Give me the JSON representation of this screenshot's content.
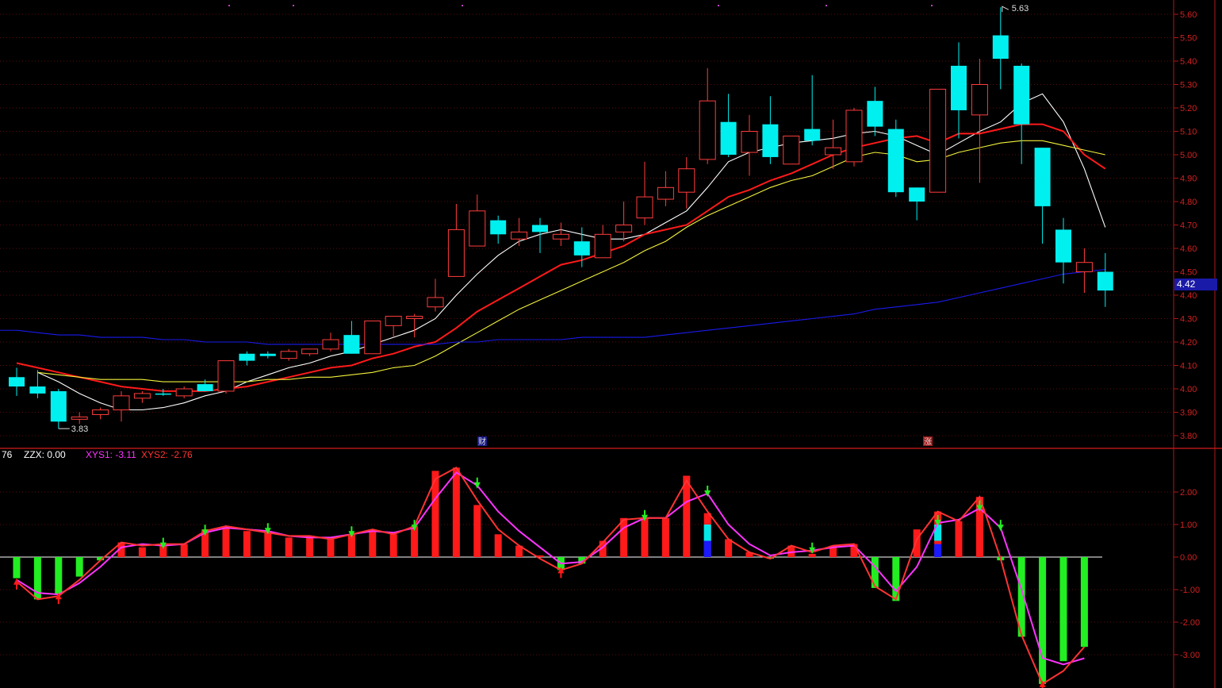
{
  "chart_data": [
    {
      "type": "candlestick",
      "title": "",
      "ylim": [
        3.75,
        5.65
      ],
      "yticks": [
        "5.60",
        "5.50",
        "5.40",
        "5.30",
        "5.20",
        "5.10",
        "5.00",
        "4.90",
        "4.80",
        "4.70",
        "4.60",
        "4.50",
        "4.40",
        "4.30",
        "4.20",
        "4.10",
        "4.00",
        "3.90",
        "3.80"
      ],
      "grid": true,
      "last_price": "4.42",
      "high_label": "5.63",
      "low_label": "3.83",
      "event_markers": [
        "财",
        "涨"
      ],
      "candles": [
        {
          "o": 4.05,
          "h": 4.09,
          "l": 3.97,
          "c": 4.01,
          "up": false
        },
        {
          "o": 4.01,
          "h": 4.08,
          "l": 3.96,
          "c": 3.98,
          "up": false
        },
        {
          "o": 3.99,
          "h": 4.0,
          "l": 3.83,
          "c": 3.86,
          "up": false
        },
        {
          "o": 3.87,
          "h": 3.9,
          "l": 3.85,
          "c": 3.88,
          "up": true
        },
        {
          "o": 3.89,
          "h": 3.92,
          "l": 3.87,
          "c": 3.91,
          "up": true
        },
        {
          "o": 3.91,
          "h": 3.99,
          "l": 3.86,
          "c": 3.97,
          "up": true
        },
        {
          "o": 3.96,
          "h": 3.99,
          "l": 3.94,
          "c": 3.98,
          "up": true
        },
        {
          "o": 3.98,
          "h": 4.0,
          "l": 3.97,
          "c": 3.98,
          "up": false
        },
        {
          "o": 3.97,
          "h": 4.01,
          "l": 3.96,
          "c": 4.0,
          "up": true
        },
        {
          "o": 4.02,
          "h": 4.04,
          "l": 3.99,
          "c": 3.99,
          "up": false
        },
        {
          "o": 3.99,
          "h": 4.12,
          "l": 3.98,
          "c": 4.12,
          "up": true
        },
        {
          "o": 4.15,
          "h": 4.16,
          "l": 4.1,
          "c": 4.12,
          "up": false
        },
        {
          "o": 4.14,
          "h": 4.16,
          "l": 4.13,
          "c": 4.15,
          "up": false
        },
        {
          "o": 4.13,
          "h": 4.17,
          "l": 4.12,
          "c": 4.16,
          "up": true
        },
        {
          "o": 4.15,
          "h": 4.17,
          "l": 4.14,
          "c": 4.17,
          "up": true
        },
        {
          "o": 4.17,
          "h": 4.24,
          "l": 4.16,
          "c": 4.21,
          "up": true
        },
        {
          "o": 4.23,
          "h": 4.29,
          "l": 4.15,
          "c": 4.15,
          "up": false
        },
        {
          "o": 4.15,
          "h": 4.29,
          "l": 4.15,
          "c": 4.29,
          "up": true
        },
        {
          "o": 4.27,
          "h": 4.31,
          "l": 4.22,
          "c": 4.31,
          "up": true
        },
        {
          "o": 4.3,
          "h": 4.32,
          "l": 4.22,
          "c": 4.31,
          "up": true
        },
        {
          "o": 4.35,
          "h": 4.47,
          "l": 4.33,
          "c": 4.39,
          "up": true
        },
        {
          "o": 4.48,
          "h": 4.79,
          "l": 4.48,
          "c": 4.68,
          "up": true
        },
        {
          "o": 4.61,
          "h": 4.83,
          "l": 4.61,
          "c": 4.76,
          "up": true
        },
        {
          "o": 4.72,
          "h": 4.74,
          "l": 4.62,
          "c": 4.66,
          "up": false
        },
        {
          "o": 4.64,
          "h": 4.73,
          "l": 4.61,
          "c": 4.67,
          "up": true
        },
        {
          "o": 4.7,
          "h": 4.73,
          "l": 4.58,
          "c": 4.67,
          "up": false
        },
        {
          "o": 4.64,
          "h": 4.71,
          "l": 4.61,
          "c": 4.66,
          "up": true
        },
        {
          "o": 4.63,
          "h": 4.69,
          "l": 4.52,
          "c": 4.57,
          "up": false
        },
        {
          "o": 4.56,
          "h": 4.7,
          "l": 4.56,
          "c": 4.66,
          "up": true
        },
        {
          "o": 4.67,
          "h": 4.8,
          "l": 4.63,
          "c": 4.7,
          "up": true
        },
        {
          "o": 4.73,
          "h": 4.97,
          "l": 4.7,
          "c": 4.82,
          "up": true
        },
        {
          "o": 4.81,
          "h": 4.93,
          "l": 4.78,
          "c": 4.86,
          "up": true
        },
        {
          "o": 4.84,
          "h": 4.99,
          "l": 4.77,
          "c": 4.94,
          "up": true
        },
        {
          "o": 4.98,
          "h": 5.37,
          "l": 4.96,
          "c": 5.23,
          "up": true
        },
        {
          "o": 5.14,
          "h": 5.26,
          "l": 4.99,
          "c": 5.0,
          "up": false
        },
        {
          "o": 5.01,
          "h": 5.17,
          "l": 4.91,
          "c": 5.1,
          "up": true
        },
        {
          "o": 5.13,
          "h": 5.25,
          "l": 4.96,
          "c": 4.99,
          "up": false
        },
        {
          "o": 4.96,
          "h": 5.08,
          "l": 4.96,
          "c": 5.08,
          "up": true
        },
        {
          "o": 5.11,
          "h": 5.34,
          "l": 5.04,
          "c": 5.06,
          "up": false
        },
        {
          "o": 5.0,
          "h": 5.15,
          "l": 4.94,
          "c": 5.03,
          "up": true
        },
        {
          "o": 4.97,
          "h": 5.2,
          "l": 4.95,
          "c": 5.19,
          "up": true
        },
        {
          "o": 5.23,
          "h": 5.29,
          "l": 5.08,
          "c": 5.12,
          "up": false
        },
        {
          "o": 5.11,
          "h": 5.15,
          "l": 4.82,
          "c": 4.84,
          "up": false
        },
        {
          "o": 4.86,
          "h": 4.86,
          "l": 4.72,
          "c": 4.8,
          "up": false
        },
        {
          "o": 4.84,
          "h": 5.28,
          "l": 4.84,
          "c": 5.28,
          "up": true
        },
        {
          "o": 5.38,
          "h": 5.48,
          "l": 5.07,
          "c": 5.19,
          "up": false
        },
        {
          "o": 5.17,
          "h": 5.41,
          "l": 4.88,
          "c": 5.3,
          "up": true
        },
        {
          "o": 5.51,
          "h": 5.63,
          "l": 5.28,
          "c": 5.41,
          "up": false
        },
        {
          "o": 5.38,
          "h": 5.39,
          "l": 4.96,
          "c": 5.13,
          "up": false
        },
        {
          "o": 5.03,
          "h": 5.03,
          "l": 4.62,
          "c": 4.78,
          "up": false
        },
        {
          "o": 4.68,
          "h": 4.73,
          "l": 4.45,
          "c": 4.54,
          "up": false
        },
        {
          "o": 4.5,
          "h": 4.6,
          "l": 4.41,
          "c": 4.54,
          "up": true
        },
        {
          "o": 4.5,
          "h": 4.58,
          "l": 4.35,
          "c": 4.42,
          "up": false
        }
      ],
      "series": [
        {
          "color": "#ffffff",
          "values": [
            4.07,
            4.03,
            3.98,
            3.94,
            3.91,
            3.91,
            3.92,
            3.94,
            3.97,
            3.99,
            4.03,
            4.06,
            4.09,
            4.11,
            4.14,
            4.16,
            4.19,
            4.22,
            4.25,
            4.3,
            4.4,
            4.49,
            4.57,
            4.63,
            4.66,
            4.68,
            4.66,
            4.64,
            4.64,
            4.66,
            4.71,
            4.76,
            4.86,
            4.97,
            5.01,
            5.03,
            5.05,
            5.06,
            5.07,
            5.09,
            5.1,
            5.08,
            5.04,
            5.0,
            5.05,
            5.1,
            5.14,
            5.22,
            5.26,
            5.14,
            4.94,
            4.69
          ]
        },
        {
          "color": "#ff1a1a",
          "values": [
            4.11,
            4.09,
            4.07,
            4.05,
            4.03,
            4.01,
            4.0,
            3.99,
            3.99,
            3.99,
            4.0,
            4.01,
            4.03,
            4.05,
            4.07,
            4.09,
            4.1,
            4.13,
            4.15,
            4.18,
            4.2,
            4.26,
            4.33,
            4.38,
            4.43,
            4.48,
            4.53,
            4.55,
            4.58,
            4.61,
            4.66,
            4.68,
            4.7,
            4.76,
            4.82,
            4.85,
            4.89,
            4.92,
            4.96,
            5.0,
            5.03,
            5.05,
            5.07,
            5.08,
            5.05,
            5.09,
            5.09,
            5.11,
            5.13,
            5.13,
            5.1,
            5.0,
            4.94
          ]
        },
        {
          "color": "#f2f23c",
          "values": [
            4.07,
            4.06,
            4.05,
            4.04,
            4.04,
            4.04,
            4.03,
            4.03,
            4.03,
            4.03,
            4.03,
            4.04,
            4.04,
            4.05,
            4.05,
            4.06,
            4.07,
            4.09,
            4.1,
            4.14,
            4.19,
            4.24,
            4.29,
            4.34,
            4.38,
            4.42,
            4.46,
            4.5,
            4.54,
            4.59,
            4.63,
            4.69,
            4.74,
            4.78,
            4.82,
            4.86,
            4.89,
            4.91,
            4.95,
            4.99,
            5.01,
            5.0,
            4.97,
            4.98,
            5.01,
            5.03,
            5.05,
            5.06,
            5.06,
            5.04,
            5.02,
            5.0
          ]
        },
        {
          "color": "#1a1aee",
          "values": [
            4.25,
            4.24,
            4.23,
            4.23,
            4.22,
            4.22,
            4.22,
            4.21,
            4.21,
            4.2,
            4.2,
            4.2,
            4.19,
            4.19,
            4.19,
            4.19,
            4.19,
            4.19,
            4.19,
            4.19,
            4.19,
            4.2,
            4.2,
            4.21,
            4.21,
            4.21,
            4.21,
            4.22,
            4.22,
            4.22,
            4.22,
            4.23,
            4.24,
            4.25,
            4.26,
            4.27,
            4.28,
            4.29,
            4.3,
            4.31,
            4.32,
            4.34,
            4.35,
            4.36,
            4.37,
            4.39,
            4.41,
            4.43,
            4.45,
            4.47,
            4.49,
            4.5,
            4.51
          ]
        }
      ]
    },
    {
      "type": "bar",
      "ylim": [
        -3.4,
        3.0
      ],
      "yticks": [
        "2.00",
        "1.00",
        "0.00",
        "-1.00",
        "-2.00",
        "-3.00"
      ],
      "legend": [
        {
          "text": "76",
          "color": "#ffffff"
        },
        {
          "text": "ZZX: 0.00",
          "color": "#ffffff"
        },
        {
          "text": "XYS1: -3.11",
          "color": "#ff33ff"
        },
        {
          "text": "XYS2: -2.76",
          "color": "#ff3333"
        }
      ],
      "values": [
        -0.65,
        -1.3,
        -1.15,
        -0.6,
        -0.1,
        0.45,
        0.3,
        0.4,
        0.4,
        0.85,
        0.95,
        0.8,
        0.75,
        0.6,
        0.65,
        0.55,
        0.7,
        0.85,
        0.7,
        0.95,
        2.65,
        2.75,
        1.6,
        0.7,
        0.35,
        0.05,
        -0.4,
        -0.2,
        0.5,
        1.2,
        1.2,
        1.2,
        2.5,
        1.35,
        0.55,
        0.15,
        -0.05,
        0.35,
        0.1,
        0.35,
        0.4,
        -0.95,
        -1.35,
        0.85,
        1.4,
        1.1,
        1.85,
        -0.1,
        -2.45,
        -3.9,
        -3.2,
        -2.76
      ],
      "series": [
        {
          "name": "XYS1",
          "color": "#ff33ff",
          "values": [
            -0.7,
            -1.1,
            -1.15,
            -0.8,
            -0.3,
            0.3,
            0.4,
            0.35,
            0.4,
            0.75,
            0.9,
            0.85,
            0.8,
            0.65,
            0.6,
            0.6,
            0.7,
            0.8,
            0.75,
            0.9,
            1.8,
            2.6,
            2.2,
            1.4,
            0.8,
            0.3,
            -0.2,
            -0.15,
            0.3,
            0.9,
            1.2,
            1.2,
            1.7,
            1.95,
            1.0,
            0.4,
            0.05,
            0.15,
            0.2,
            0.3,
            0.35,
            -0.3,
            -1.05,
            -0.3,
            1.05,
            1.15,
            1.5,
            0.9,
            -1.0,
            -3.1,
            -3.3,
            -3.11
          ]
        },
        {
          "name": "XYS2",
          "color": "#ff3333",
          "values": [
            -0.75,
            -1.3,
            -1.2,
            -0.7,
            -0.1,
            0.45,
            0.35,
            0.4,
            0.4,
            0.8,
            0.95,
            0.85,
            0.75,
            0.65,
            0.65,
            0.55,
            0.7,
            0.85,
            0.7,
            0.95,
            2.4,
            2.75,
            1.75,
            0.85,
            0.35,
            -0.05,
            -0.4,
            -0.2,
            0.45,
            1.15,
            1.2,
            1.2,
            2.35,
            1.4,
            0.55,
            0.15,
            -0.05,
            0.35,
            0.15,
            0.35,
            0.4,
            -0.9,
            -1.3,
            0.55,
            1.4,
            1.1,
            1.85,
            -0.05,
            -2.4,
            -3.9,
            -3.5,
            -2.76
          ]
        }
      ],
      "down_arrows": [
        7,
        9,
        12,
        16,
        19,
        22,
        30,
        33,
        38,
        44,
        46,
        47
      ],
      "up_arrows": [
        0,
        2,
        26,
        49
      ]
    }
  ]
}
